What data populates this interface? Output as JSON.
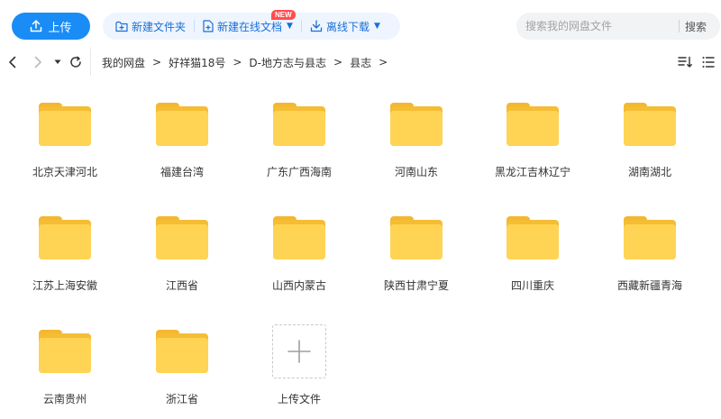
{
  "toolbar": {
    "upload_label": "上传",
    "new_folder_label": "新建文件夹",
    "new_online_doc_label": "新建在线文档",
    "new_badge": "NEW",
    "offline_download_label": "离线下载",
    "accent_color": "#1a8cf5"
  },
  "search": {
    "placeholder": "搜索我的网盘文件",
    "button_label": "搜索"
  },
  "breadcrumb": {
    "items": [
      "我的网盘",
      "好祥猫18号",
      "D-地方志与县志",
      "县志"
    ],
    "separator": ">"
  },
  "folders": [
    {
      "name": "北京天津河北"
    },
    {
      "name": "福建台湾"
    },
    {
      "name": "广东广西海南"
    },
    {
      "name": "河南山东"
    },
    {
      "name": "黑龙江吉林辽宁"
    },
    {
      "name": "湖南湖北"
    },
    {
      "name": "江苏上海安徽"
    },
    {
      "name": "江西省"
    },
    {
      "name": "山西内蒙古"
    },
    {
      "name": "陕西甘肃宁夏"
    },
    {
      "name": "四川重庆"
    },
    {
      "name": "西藏新疆青海"
    },
    {
      "name": "云南贵州"
    },
    {
      "name": "浙江省"
    }
  ],
  "upload_tile": {
    "label": "上传文件"
  },
  "icons": {
    "back": "chevron-left-icon",
    "forward": "chevron-right-icon",
    "history": "caret-down-icon",
    "refresh": "refresh-icon",
    "sort": "sort-icon",
    "list_view": "list-view-icon",
    "folder": "folder-icon",
    "plus": "plus-icon"
  },
  "colors": {
    "folder_front": "#ffd454",
    "folder_back": "#f5bd33",
    "badge": "#ff4d4f"
  }
}
